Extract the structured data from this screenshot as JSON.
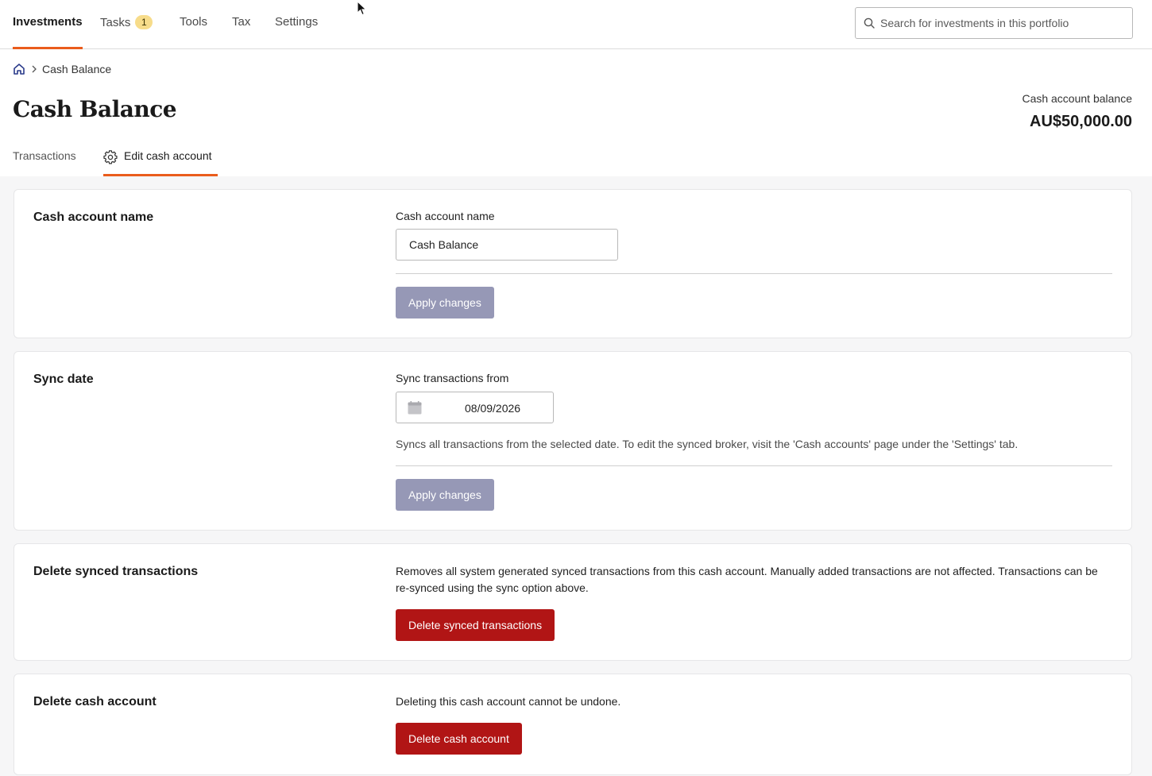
{
  "nav": {
    "items": [
      {
        "label": "Investments",
        "active": true
      },
      {
        "label": "Tasks",
        "badge": "1"
      },
      {
        "label": "Tools"
      },
      {
        "label": "Tax"
      },
      {
        "label": "Settings"
      }
    ],
    "search_placeholder": "Search for investments in this portfolio",
    "accent_color": "#ea5c1c"
  },
  "breadcrumb": {
    "home_icon": "home-icon",
    "current": "Cash Balance"
  },
  "header": {
    "title": "Cash Balance",
    "balance_label": "Cash account balance",
    "balance_value": "AU$50,000.00"
  },
  "tabs": [
    {
      "label": "Transactions",
      "active": false
    },
    {
      "label": "Edit cash account",
      "active": true,
      "icon": "gear-icon"
    }
  ],
  "sections": {
    "name": {
      "title": "Cash account name",
      "field_label": "Cash account name",
      "field_value": "Cash Balance",
      "button": "Apply changes"
    },
    "sync": {
      "title": "Sync date",
      "field_label": "Sync transactions from",
      "date_value": "08/09/2026",
      "help": "Syncs all transactions from the selected date. To edit the synced broker, visit the 'Cash accounts' page under the 'Settings' tab.",
      "button": "Apply changes"
    },
    "delete_synced": {
      "title": "Delete synced transactions",
      "description": "Removes all system generated synced transactions from this cash account. Manually added transactions are not affected. Transactions can be re-synced using the sync option above.",
      "button": "Delete synced transactions"
    },
    "delete_account": {
      "title": "Delete cash account",
      "description": "Deleting this cash account cannot be undone.",
      "button": "Delete cash account"
    }
  },
  "colors": {
    "danger": "#b11515",
    "disabled_button": "#9698b6"
  }
}
